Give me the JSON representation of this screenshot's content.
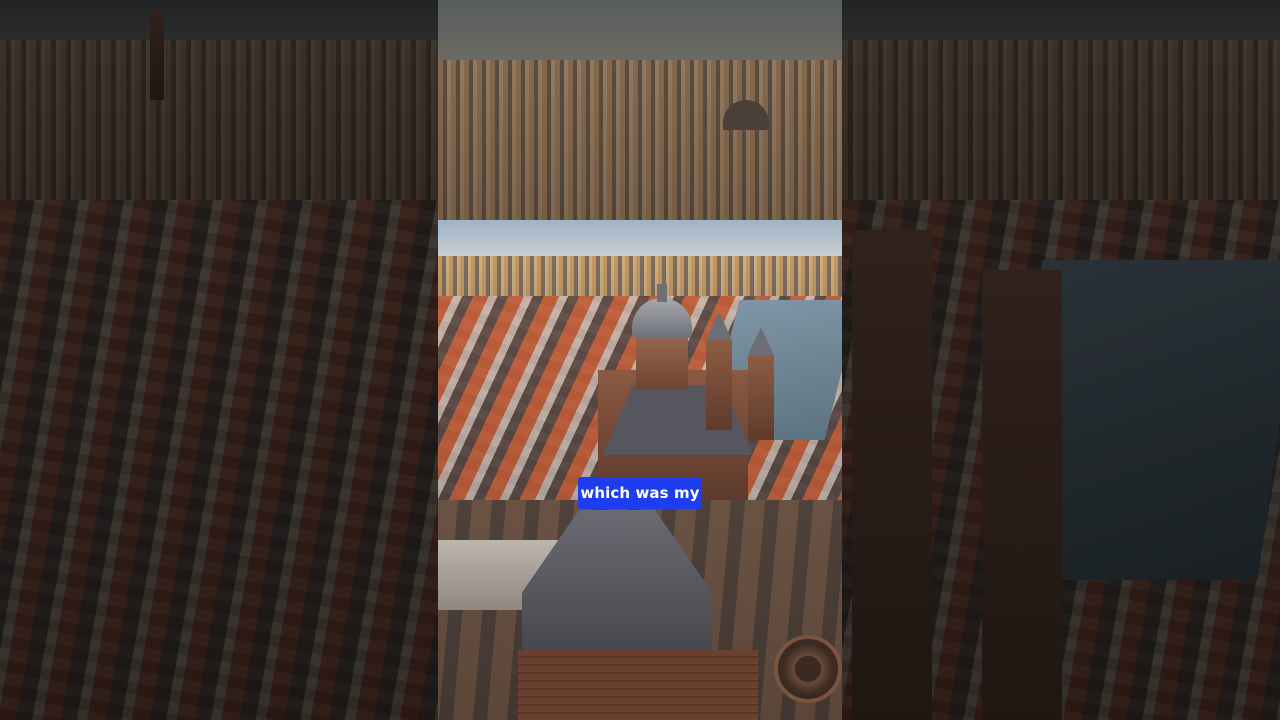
{
  "video": {
    "caption": "which was my"
  }
}
